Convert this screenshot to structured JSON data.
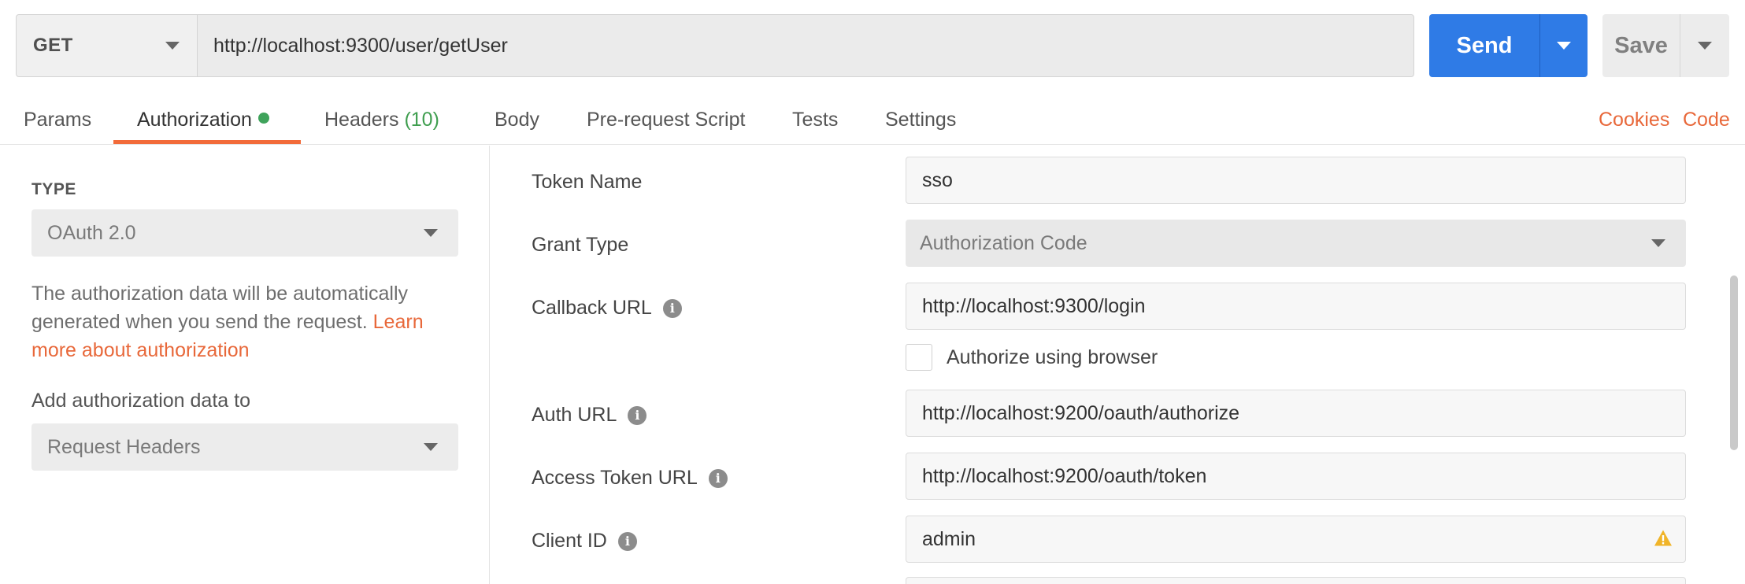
{
  "request": {
    "method": "GET",
    "url": "http://localhost:9300/user/getUser",
    "send_label": "Send",
    "save_label": "Save"
  },
  "tabs": [
    {
      "label": "Params"
    },
    {
      "label": "Authorization",
      "active": true
    },
    {
      "label": "Headers",
      "count": "(10)"
    },
    {
      "label": "Body"
    },
    {
      "label": "Pre-request Script"
    },
    {
      "label": "Tests"
    },
    {
      "label": "Settings"
    }
  ],
  "tab_links": {
    "cookies": "Cookies",
    "code": "Code"
  },
  "auth": {
    "type_label": "TYPE",
    "type_value": "OAuth 2.0",
    "description": "The authorization data will be automatically generated when you send the request.",
    "learn_more": "Learn more about authorization",
    "add_to_label": "Add authorization data to",
    "add_to_value": "Request Headers"
  },
  "fields": {
    "token_name": {
      "label": "Token Name",
      "value": "sso"
    },
    "grant_type": {
      "label": "Grant Type",
      "value": "Authorization Code"
    },
    "callback_url": {
      "label": "Callback URL",
      "value": "http://localhost:9300/login"
    },
    "authorize_browser": {
      "label": "Authorize using browser",
      "checked": false
    },
    "auth_url": {
      "label": "Auth URL",
      "value": "http://localhost:9200/oauth/authorize"
    },
    "access_token_url": {
      "label": "Access Token URL",
      "value": "http://localhost:9200/oauth/token"
    },
    "client_id": {
      "label": "Client ID",
      "value": "admin",
      "warning": true
    }
  },
  "icons": {
    "info": "i",
    "warning": "warning-icon"
  },
  "colors": {
    "accent": "#f26b3a",
    "primary": "#2f7be6",
    "success": "#3fa35b",
    "warning": "#f0b429"
  }
}
